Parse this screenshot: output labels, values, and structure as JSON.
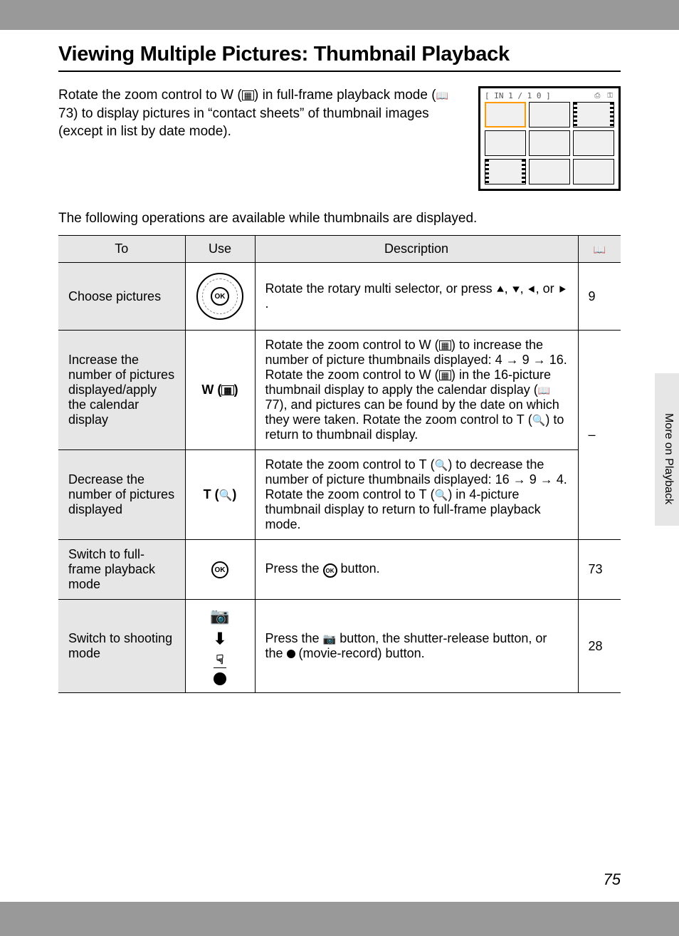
{
  "title": "Viewing Multiple Pictures: Thumbnail Playback",
  "intro": "Rotate the zoom control to W (■■) in full-frame playback mode (📖 73) to display pictures in \"contact sheets\" of thumbnail images (except in list by date mode).",
  "thumb_counter": "[ IN   1 /   1 0 ]",
  "lead": "The following operations are available while thumbnails are displayed.",
  "headers": {
    "to": "To",
    "use": "Use",
    "desc": "Description",
    "ref": "📖"
  },
  "rows": [
    {
      "to": "Choose pictures",
      "use_type": "dial",
      "desc": "Rotate the rotary multi selector, or press ▲, ▼, ◀, or ▶.",
      "ref": "9"
    },
    {
      "to": "Increase the number of pictures displayed/apply the calendar display",
      "use": "W (■■)",
      "desc": "Rotate the zoom control to W (■■) to increase the number of picture thumbnails displayed: 4 → 9 → 16. Rotate the zoom control to W (■■) in the 16-picture thumbnail display to apply the calendar display (📖 77), and pictures can be found by the date on which they were taken. Rotate the zoom control to T (🔍) to return to thumbnail display.",
      "ref_span": "–"
    },
    {
      "to": "Decrease the number of pictures displayed",
      "use": "T (🔍)",
      "desc": "Rotate the zoom control to T (🔍) to decrease the number of picture thumbnails displayed: 16 → 9 → 4. Rotate the zoom control to T (🔍) in 4-picture thumbnail display to return to full-frame playback mode."
    },
    {
      "to": "Switch to full-frame playback mode",
      "use_type": "ok",
      "desc": "Press the OK button.",
      "ref": "73"
    },
    {
      "to": "Switch to shooting mode",
      "use_type": "stack",
      "desc": "Press the 📷 button, the shutter-release button, or the ● (movie-record) button.",
      "ref": "28"
    }
  ],
  "side_label": "More on Playback",
  "page_num": "75"
}
